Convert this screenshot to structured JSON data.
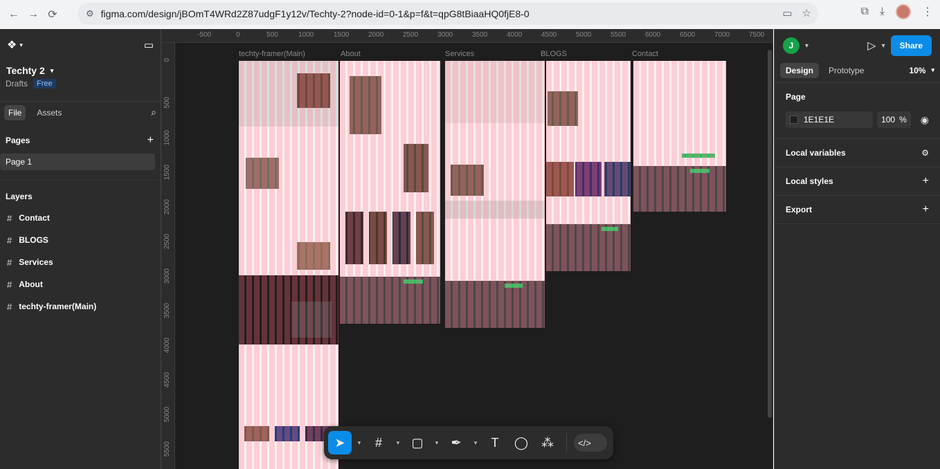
{
  "browser": {
    "url": "figma.com/design/jBOmT4WRd2Z87udgF1y12v/Techty-2?node-id=0-1&p=f&t=qpG8tBiaaHQ0fjE8-0"
  },
  "left": {
    "file_title": "Techty 2",
    "drafts_label": "Drafts",
    "plan_badge": "Free",
    "tabs": [
      "File",
      "Assets"
    ],
    "pages_header": "Pages",
    "current_page": "Page 1",
    "layers_header": "Layers",
    "layers": [
      "Contact",
      "BLOGS",
      "Services",
      "About",
      "techty-framer(Main)"
    ]
  },
  "canvas": {
    "ruler_x": [
      "-500",
      "0",
      "500",
      "1000",
      "1500",
      "2000",
      "2500",
      "3000",
      "3500",
      "4000",
      "4500",
      "5000",
      "5500",
      "6000",
      "6500",
      "7000",
      "7500"
    ],
    "ruler_y": [
      "0",
      "500",
      "1000",
      "1500",
      "2000",
      "2500",
      "3000",
      "3500",
      "4000",
      "4500",
      "5000",
      "5500"
    ],
    "frames": [
      "techty-framer(Main)",
      "About",
      "Services",
      "BLOGS",
      "Contact"
    ]
  },
  "right": {
    "user_initial": "J",
    "share_label": "Share",
    "tabs": [
      "Design",
      "Prototype"
    ],
    "zoom": "10%",
    "page_section": "Page",
    "bg_color": "1E1E1E",
    "bg_opacity": "100",
    "opacity_unit": "%",
    "local_variables": "Local variables",
    "local_styles": "Local styles",
    "export": "Export"
  },
  "help_label": "?"
}
